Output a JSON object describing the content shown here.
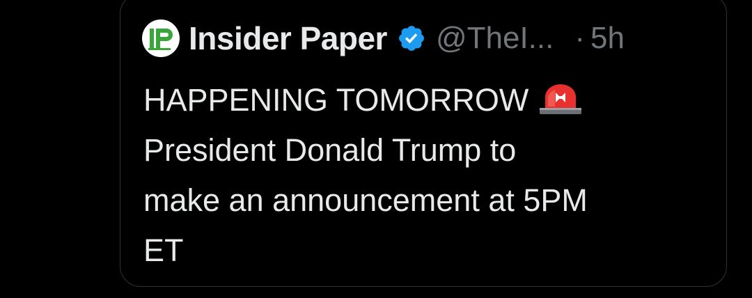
{
  "tweet": {
    "author": {
      "avatar_text": "IP",
      "display_name": "Insider Paper",
      "handle": "@TheI...",
      "verified": true
    },
    "separator": "·",
    "timestamp": "5h",
    "text_lines": [
      "HAPPENING TOMORROW",
      "President Donald Trump to",
      "make an announcement at 5PM",
      "ET"
    ],
    "emoji": "police-car-light-emoji"
  },
  "colors": {
    "background": "#000000",
    "border": "#2f3336",
    "primary_text": "#e7e9ea",
    "secondary_text": "#71767b",
    "verified_blue": "#1d9bf0",
    "avatar_green": "#3aa63a",
    "siren_red": "#e8312f"
  }
}
